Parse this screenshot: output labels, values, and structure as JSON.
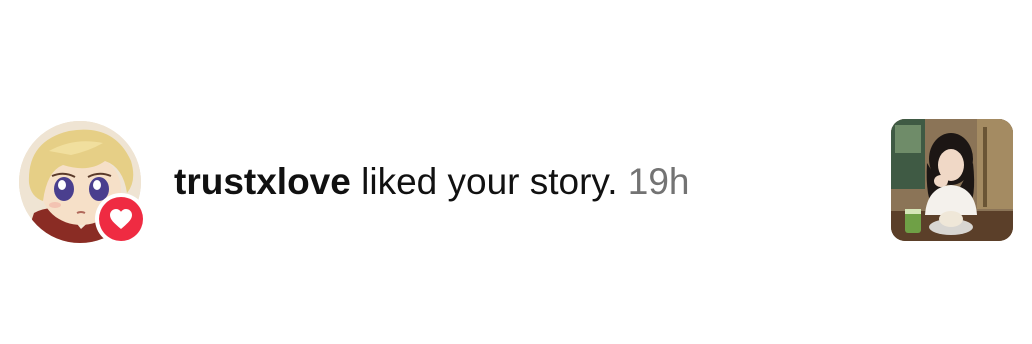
{
  "notification": {
    "username": "trustxlove",
    "action_text": " liked your story. ",
    "timestamp": "19h"
  },
  "icons": {
    "badge": "heart-icon"
  },
  "colors": {
    "text": "#111111",
    "timestamp": "#737373",
    "like_red": "#ef2b42",
    "background": "#ffffff"
  }
}
